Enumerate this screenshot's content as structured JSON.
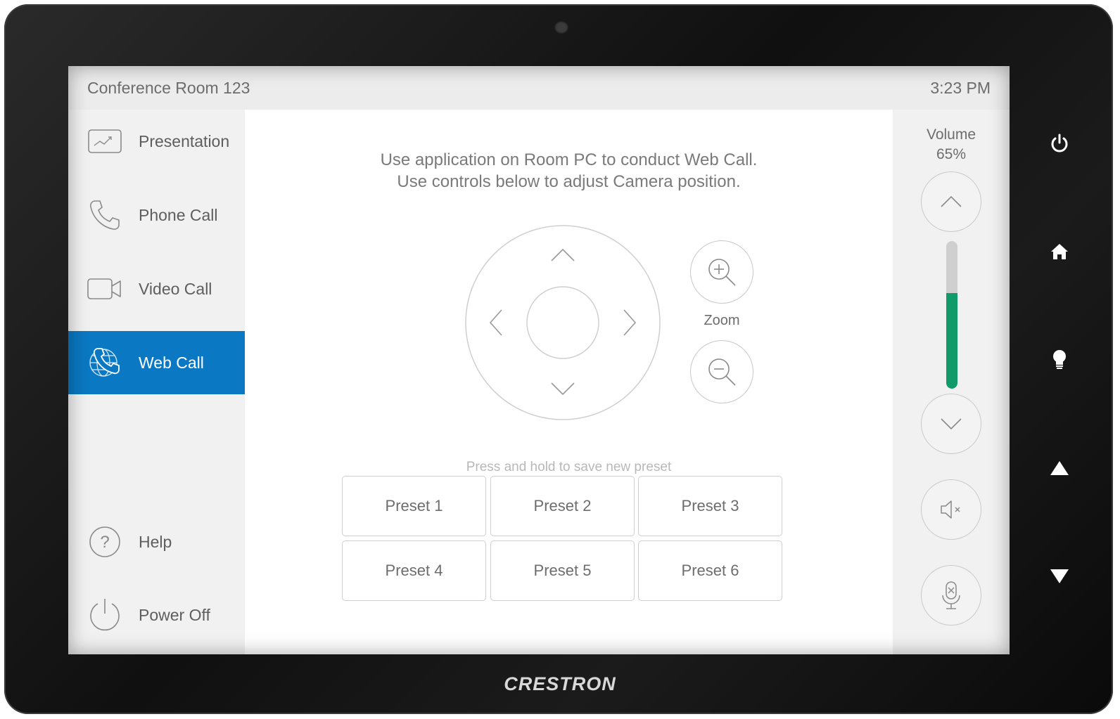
{
  "device": {
    "brand": "CRESTRON"
  },
  "header": {
    "room_name": "Conference Room 123",
    "time": "3:23 PM"
  },
  "sidebar": {
    "items": [
      {
        "label": "Presentation",
        "icon": "presentation-icon",
        "active": false
      },
      {
        "label": "Phone Call",
        "icon": "phone-icon",
        "active": false
      },
      {
        "label": "Video Call",
        "icon": "video-camera-icon",
        "active": false
      },
      {
        "label": "Web Call",
        "icon": "globe-phone-icon",
        "active": true
      }
    ],
    "bottom_items": [
      {
        "label": "Help",
        "icon": "help-icon"
      },
      {
        "label": "Power Off",
        "icon": "power-icon"
      }
    ],
    "active_color": "#0a78c2"
  },
  "main": {
    "instruction_line1": "Use application on Room PC to conduct Web Call.",
    "instruction_line2": "Use controls below to adjust Camera position.",
    "zoom_label": "Zoom",
    "preset_hint": "Press and hold to save new preset",
    "presets": [
      "Preset 1",
      "Preset 2",
      "Preset 3",
      "Preset 4",
      "Preset 5",
      "Preset 6"
    ]
  },
  "volume": {
    "label": "Volume",
    "level_text": "65%",
    "level": 0.65,
    "fill_color": "#119a6a"
  }
}
